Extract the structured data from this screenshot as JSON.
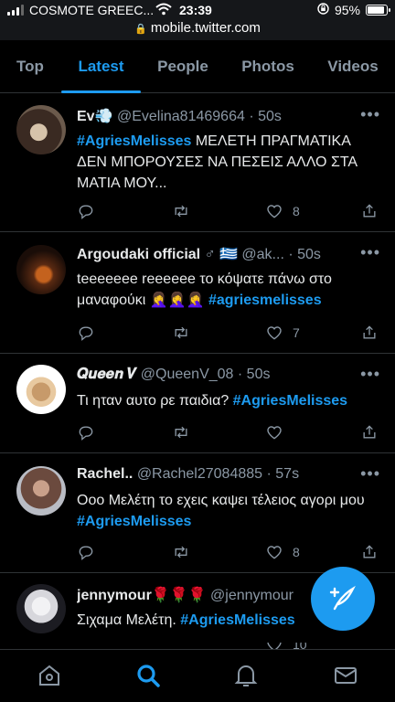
{
  "status_bar": {
    "carrier": "COSMOTE GREEC...",
    "time": "23:39",
    "battery": "95%",
    "battery_level": 0.95
  },
  "url_bar": {
    "url": "mobile.twitter.com"
  },
  "tabs": [
    {
      "label": "Top",
      "active": false
    },
    {
      "label": "Latest",
      "active": true
    },
    {
      "label": "People",
      "active": false
    },
    {
      "label": "Photos",
      "active": false
    },
    {
      "label": "Videos",
      "active": false
    }
  ],
  "tweets": [
    {
      "name": "Ev💨",
      "handle": "@Evelina81469664",
      "time": "50s",
      "hashtag": "#AgriesMelisses",
      "text": " ΜΕΛΕΤΗ ΠΡΑΓΜΑΤΙΚΑ ΔΕΝ ΜΠΟΡΟΥΣΕΣ ΝΑ ΠΕΣΕΙΣ ΑΛΛΟ ΣΤΑ ΜΑΤΙΑ ΜΟΥ...",
      "likes": "8",
      "avatar_colors": [
        "#3a2a22",
        "#d6c3aa"
      ]
    },
    {
      "name": "Argoudaki official",
      "badges": "♂ 🇬🇷",
      "handle": "@ak...",
      "time": "50s",
      "text": "teeeeeee reeeeee το κόψατε πάνω στο μαναφούκι 🤦‍♀️🤦‍♀️🤦‍♀️ ",
      "hashtag": "#agriesmelisses",
      "likes": "7",
      "avatar_colors": [
        "#1a0d08",
        "#c4621e"
      ]
    },
    {
      "name": "𝑸𝒖𝒆𝒆𝒏 𝑽",
      "handle": "@QueenV_08",
      "time": "50s",
      "text": "Τι ηταν αυτο ρε παιδια? ",
      "hashtag": "#AgriesMelisses",
      "likes": "",
      "avatar_colors": [
        "#ffffff",
        "#c79a6a"
      ]
    },
    {
      "name": "Rachel..",
      "handle": "@Rachel27084885",
      "time": "57s",
      "text": "Οοο Μελέτη το εχεις καψει τέλειος αγορι μου ",
      "hashtag": "#AgriesMelisses",
      "likes": "8",
      "avatar_colors": [
        "#6b4a3e",
        "#c9a08a"
      ]
    },
    {
      "name": "jennymour🌹🌹🌹",
      "handle": "@jennymour",
      "time": "",
      "text": "Σιχαμα Μελέτη. ",
      "hashtag": "#AgriesMelisses",
      "likes": "10",
      "avatar_colors": [
        "#1c1c22",
        "#d7d7dc"
      ]
    }
  ],
  "icons": {
    "reply": "reply-icon",
    "retweet": "retweet-icon",
    "like": "heart-icon",
    "share": "share-icon",
    "more": "more-icon"
  },
  "colors": {
    "accent": "#1d9bf0",
    "muted": "#8b98a5",
    "background": "#000000"
  },
  "bottom_nav": [
    "home-icon",
    "search-icon",
    "notifications-icon",
    "messages-icon"
  ]
}
